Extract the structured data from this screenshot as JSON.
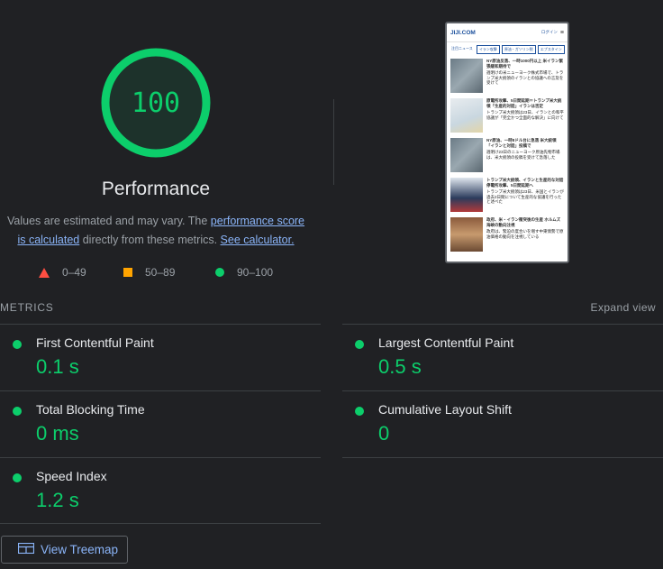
{
  "score": {
    "value": "100",
    "color": "#0cce6b"
  },
  "category": {
    "title": "Performance"
  },
  "description": {
    "text1": "Values are estimated and may vary. The ",
    "link1": "performance score",
    "link2": "is calculated",
    "text2": " directly from these metrics. ",
    "link3": "See calculator."
  },
  "legend": {
    "fail": "0–49",
    "average": "50–89",
    "pass": "90–100"
  },
  "metrics_section": {
    "label": "METRICS",
    "expand_label": "Expand view"
  },
  "metrics": [
    {
      "title": "First Contentful Paint",
      "value": "0.1 s"
    },
    {
      "title": "Largest Contentful Paint",
      "value": "0.5 s"
    },
    {
      "title": "Total Blocking Time",
      "value": "0 ms"
    },
    {
      "title": "Cumulative Layout Shift",
      "value": "0"
    },
    {
      "title": "Speed Index",
      "value": "1.2 s"
    }
  ],
  "treemap": {
    "label": "View Treemap"
  },
  "screenshot": {
    "logo": "JIJI.COM",
    "menu": "ログイン",
    "tags": [
      "注目ニュース",
      "イラン攻撃",
      "原油・ガソリン税",
      "エプスタイン"
    ],
    "items": [
      {
        "headline": "NY原油反落、一時1000円以上 米イラン緊張緩和期待で",
        "body": "週明けの米ニューヨーク株式市場で、トランプ米大統領のイランとの協議への言及を受けて"
      },
      {
        "headline": "原電所攻撃、5日間延期＝トランプ米大統領「生産的対話」イランは否定",
        "body": "トランプ米大統領は23日、イランとの和平協議が「完全かつ全面的な解決」に向けて"
      },
      {
        "headline": "NY原油、一時8ドル台に急落 米大統領「イランと対話」投稿で",
        "body": "週明け23日のニューヨーク原油先物市場は、米大統領の投稿を受けて急落した"
      },
      {
        "headline": "トランプ米大統領、イランと生産的な対話 停電所攻撃、5日間延期へ",
        "body": "トランプ米大統領は23日、米国とイランが過去2日間について生産的な協議を行ったと述べた"
      },
      {
        "headline": "政府、米・イラン衝突後の生産 ホルムズ海峡の動向注視",
        "body": "政府は、緊迫の度合いを増す中東情勢で原油価格の動向を注視している"
      }
    ]
  },
  "colors": {
    "pass": "#0cce6b",
    "average": "#ffa400",
    "fail": "#ff4e42",
    "link": "#8ab4f8",
    "background": "#202124"
  }
}
